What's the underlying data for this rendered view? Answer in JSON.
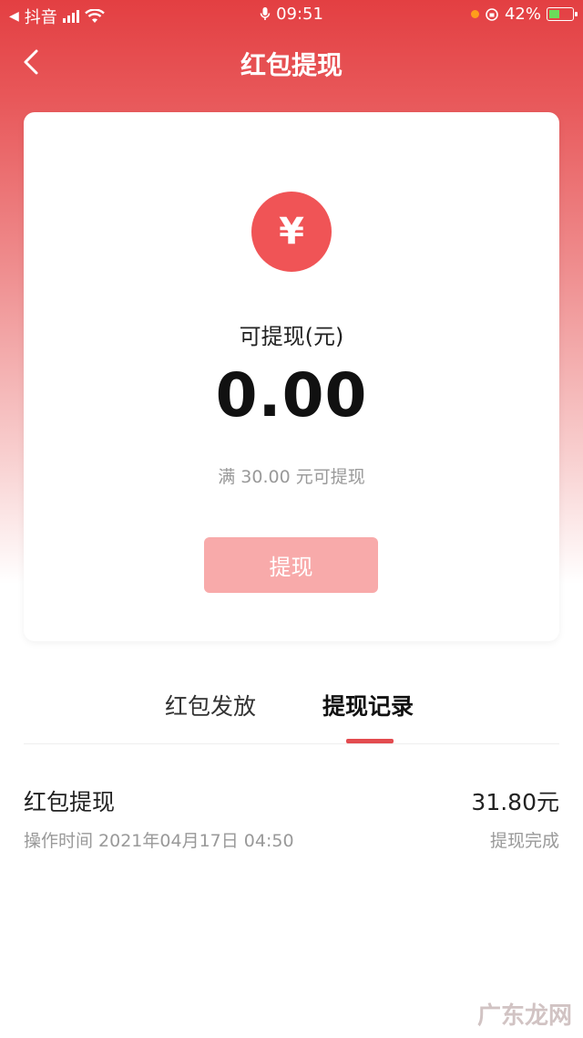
{
  "status_bar": {
    "back_app": "抖音",
    "time": "09:51",
    "battery": "42%"
  },
  "nav": {
    "title": "红包提现"
  },
  "card": {
    "currency_symbol": "¥",
    "available_label": "可提现(元)",
    "amount": "0.00",
    "threshold_text": "满 30.00 元可提现",
    "withdraw_button": "提现"
  },
  "tabs": [
    {
      "label": "红包发放",
      "active": false
    },
    {
      "label": "提现记录",
      "active": true
    }
  ],
  "records": [
    {
      "title": "红包提现",
      "amount": "31.80元",
      "time": "操作时间 2021年04月17日 04:50",
      "status": "提现完成"
    }
  ],
  "watermark": "广东龙网",
  "colors": {
    "brand_red": "#e33f42",
    "button_disabled": "#f8aaaa",
    "icon_circle": "#f05456"
  }
}
